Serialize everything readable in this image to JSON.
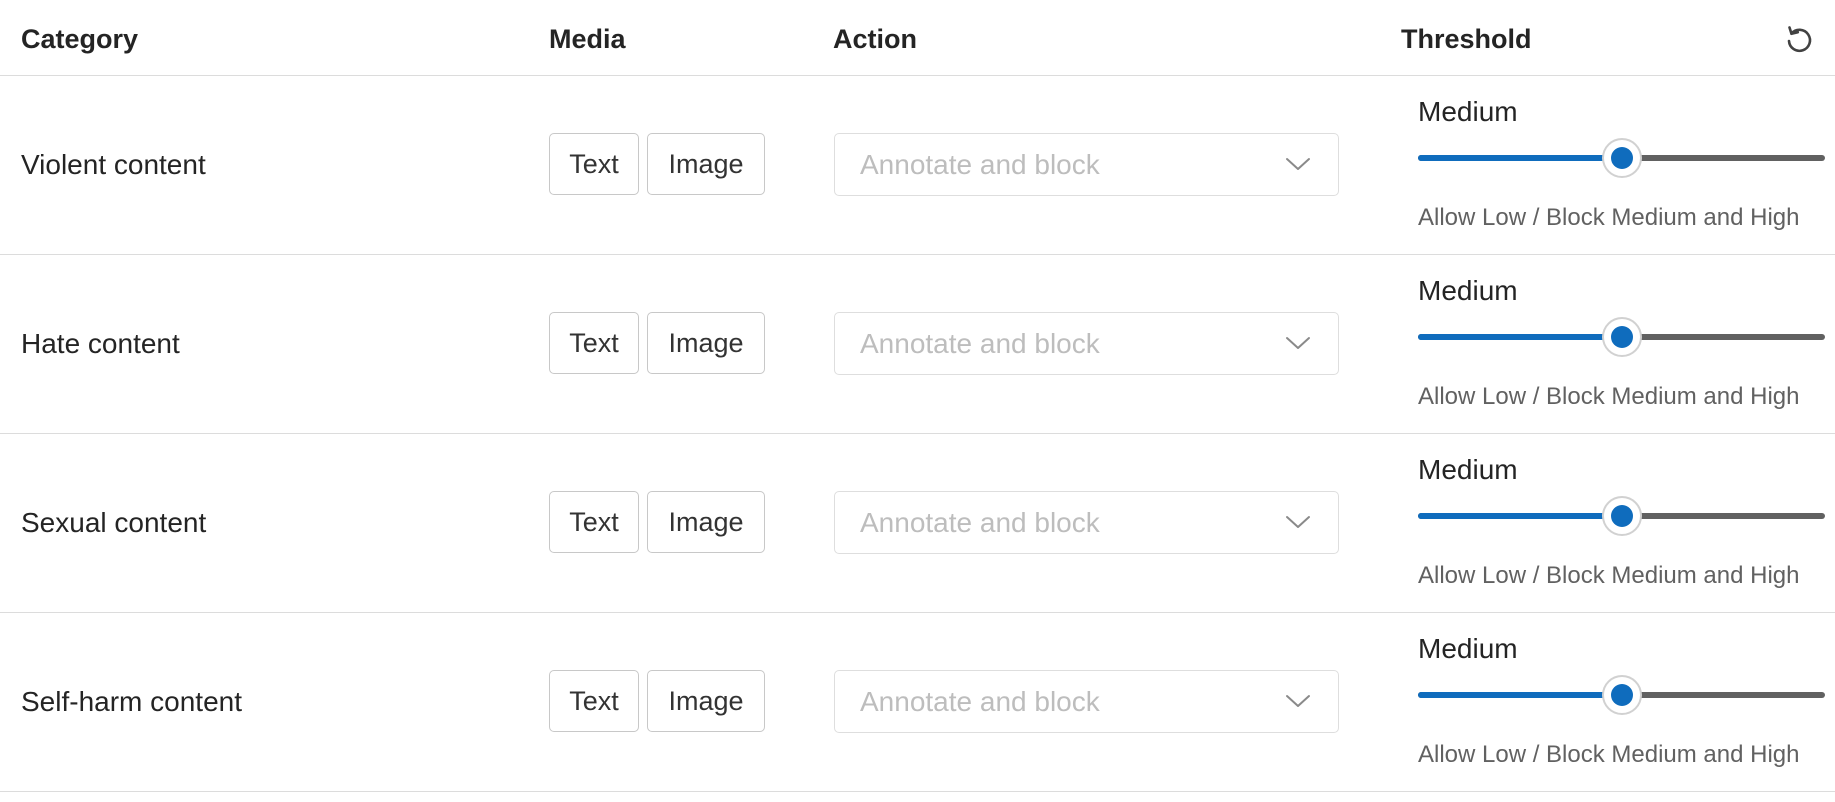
{
  "header": {
    "category": "Category",
    "media": "Media",
    "action": "Action",
    "threshold": "Threshold",
    "reset_icon": "reset-icon"
  },
  "rows": [
    {
      "category": "Violent content",
      "media": [
        "Text",
        "Image"
      ],
      "action": "Annotate and block",
      "level": "Medium",
      "slider_fraction": 0.5,
      "description": "Allow Low / Block Medium and High"
    },
    {
      "category": "Hate content",
      "media": [
        "Text",
        "Image"
      ],
      "action": "Annotate and block",
      "level": "Medium",
      "slider_fraction": 0.5,
      "description": "Allow Low / Block Medium and High"
    },
    {
      "category": "Sexual content",
      "media": [
        "Text",
        "Image"
      ],
      "action": "Annotate and block",
      "level": "Medium",
      "slider_fraction": 0.5,
      "description": "Allow Low / Block Medium and High"
    },
    {
      "category": "Self-harm content",
      "media": [
        "Text",
        "Image"
      ],
      "action": "Annotate and block",
      "level": "Medium",
      "slider_fraction": 0.5,
      "description": "Allow Low / Block Medium and High"
    }
  ],
  "colors": {
    "accent": "#0f6cbd",
    "track": "#616161",
    "border": "#dcdcdc",
    "placeholder": "#bdbdbd"
  }
}
